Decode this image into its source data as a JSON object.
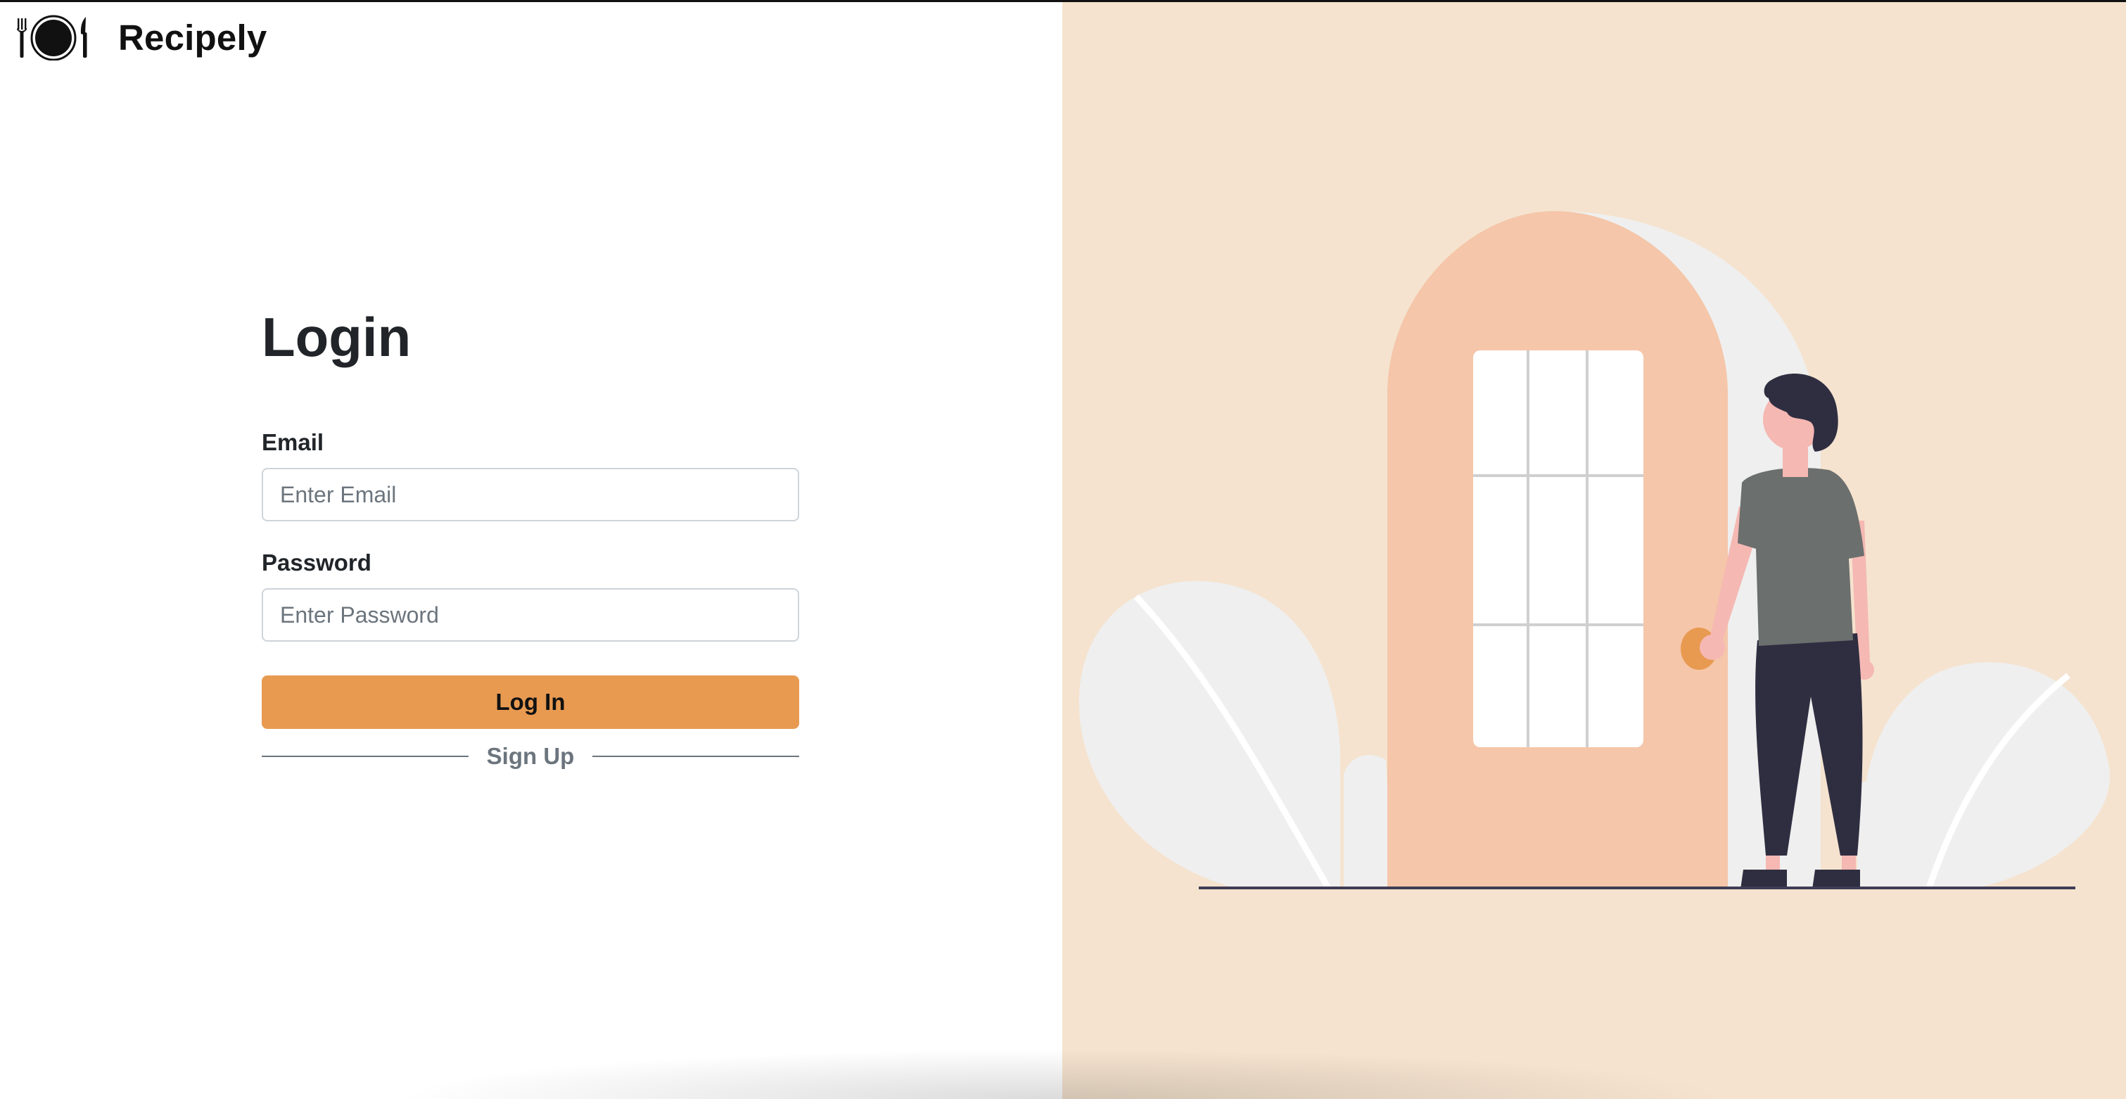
{
  "brand": {
    "name": "Recipely",
    "logo_icon": "plate-fork-knife-icon"
  },
  "login": {
    "title": "Login",
    "email_label": "Email",
    "email_placeholder": "Enter Email",
    "email_value": "",
    "password_label": "Password",
    "password_placeholder": "Enter Password",
    "password_value": "",
    "submit_label": "Log In",
    "signup_label": "Sign Up"
  },
  "colors": {
    "accent": "#e89a51",
    "illustration_background": "#f5e3cf",
    "door": "#f5c6a9",
    "shirt": "#6b6f6d",
    "trousers": "#2f2e41"
  }
}
